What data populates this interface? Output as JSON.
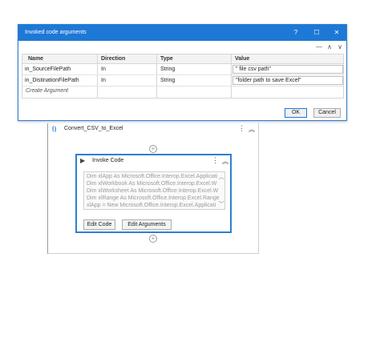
{
  "dialog": {
    "title": "Invoked code arguments",
    "title_buttons": {
      "help": "?",
      "maximize": "☐",
      "close": "✕"
    },
    "toolbar": {
      "remove": "—",
      "up": "∧",
      "down": "∨"
    },
    "columns": [
      "Name",
      "Direction",
      "Type",
      "Value"
    ],
    "rows": [
      {
        "name": "in_SourceFilePath",
        "direction": "In",
        "type": "String",
        "value": "\" file csv path\""
      },
      {
        "name": "in_DistinationFilePath",
        "direction": "In",
        "type": "String",
        "value": "\"folder path to save Excel\""
      }
    ],
    "create_argument": "Create Argument",
    "ok_label": "OK",
    "cancel_label": "Cancel"
  },
  "workflow": {
    "sequence_title": "Convert_CSV_to_Excel",
    "activity": {
      "title": "Invoke Code",
      "code_lines": [
        "Dim xlApp As Microsoft.Office.Interop.Excel.Applicati",
        "Dim xlWorkbook As Microsoft.Office.Interop.Excel.W",
        "Dim xlWorksheet As Microsoft.Office.Interop.Excel.W",
        "Dim xlRange As Microsoft.Office.Interop.Excel.Range",
        "xlApp = New Microsoft.Office.Interop.Excel.Applicati"
      ],
      "edit_code_label": "Edit Code",
      "edit_arguments_label": "Edit Arguments"
    }
  },
  "colors": {
    "accent": "#1e78d6",
    "border": "#2d7fd3"
  }
}
